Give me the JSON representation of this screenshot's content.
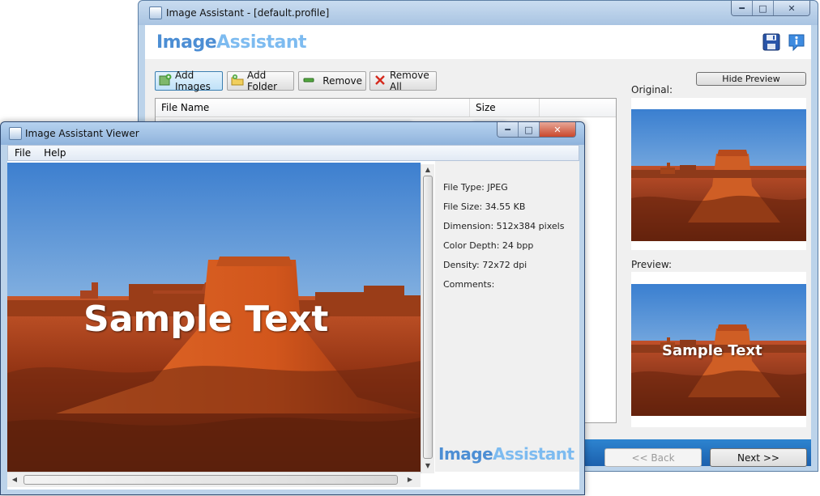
{
  "main_window": {
    "title": "Image Assistant - [default.profile]",
    "brand_part1": "Image",
    "brand_part2": "Assistant",
    "toolbar": {
      "add_images": "Add Images",
      "add_folder": "Add Folder",
      "remove": "Remove",
      "remove_all": "Remove All"
    },
    "file_list": {
      "columns": [
        "File Name",
        "Size"
      ]
    },
    "hide_preview_label": "Hide Preview",
    "original_label": "Original:",
    "preview_label": "Preview:",
    "back_label": "<< Back",
    "next_label": "Next >>",
    "icons": [
      "save-icon",
      "info-icon"
    ]
  },
  "viewer_window": {
    "title": "Image Assistant Viewer",
    "menu": [
      "File",
      "Help"
    ],
    "info": {
      "file_type": "File Type: JPEG",
      "file_size": "File Size: 34.55 KB",
      "dimension": "Dimension: 512x384 pixels",
      "color_depth": "Color Depth: 24 bpp",
      "density": "Density: 72x72 dpi",
      "comments": "Comments:"
    },
    "brand_part1": "Image",
    "brand_part2": "Assistant"
  },
  "watermark_text": "Sample Text",
  "colors": {
    "brand_dark": "#4c8ed4",
    "brand_light": "#7dbbf0",
    "bottom_strip": "#1c60ad",
    "close_button": "#c9472c"
  }
}
